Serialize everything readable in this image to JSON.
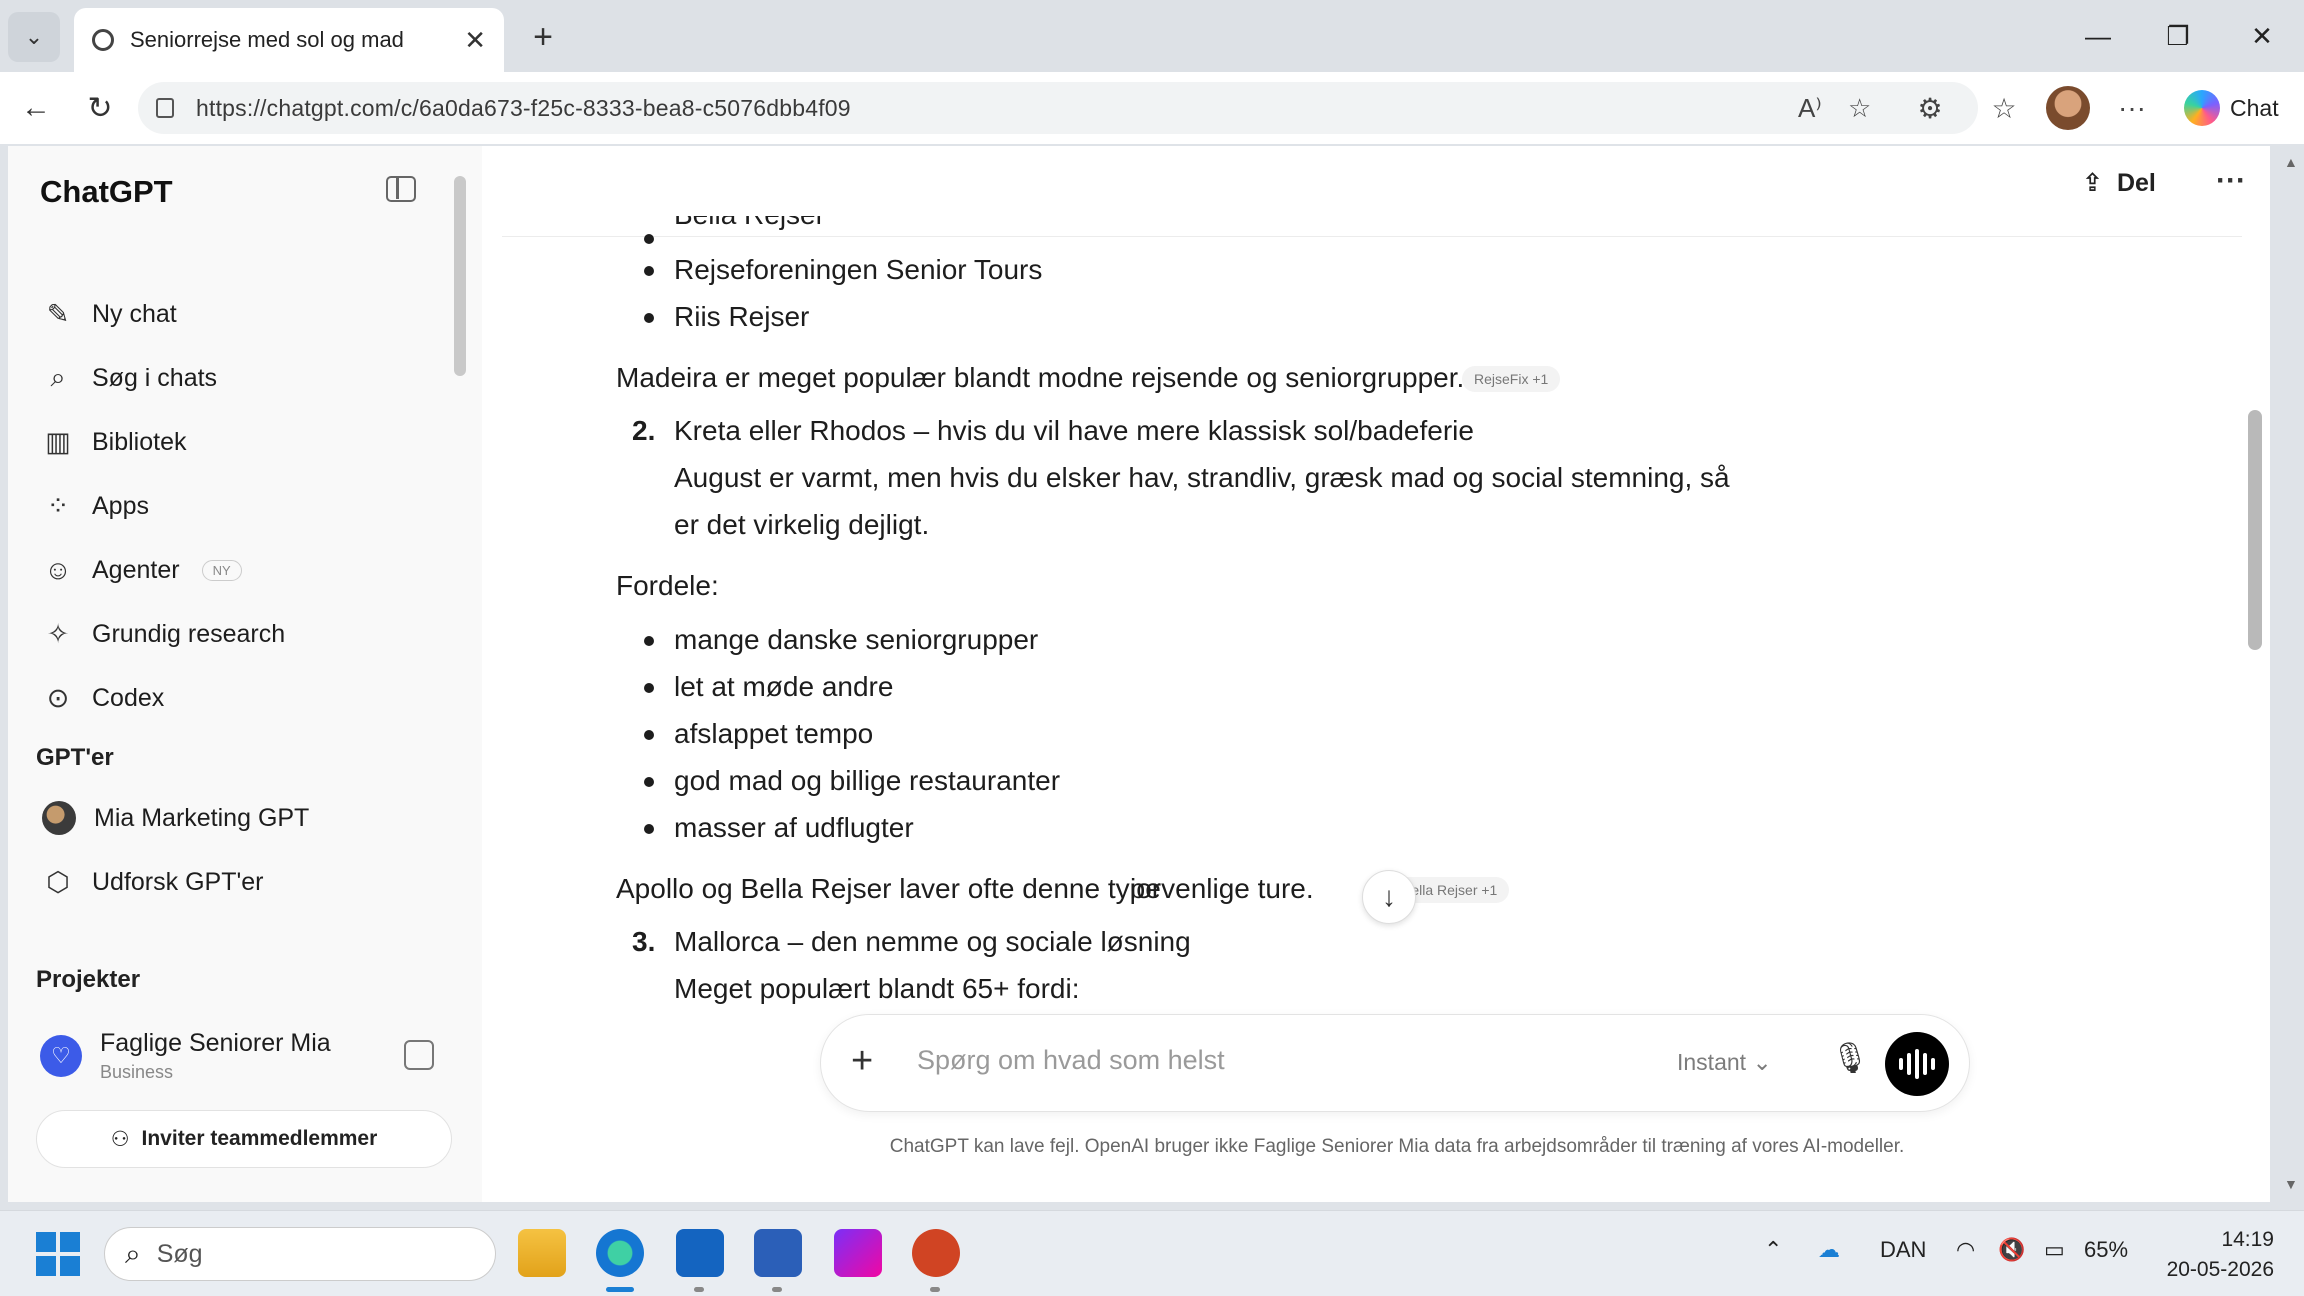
{
  "browser": {
    "tab_title": "Seniorrejse med sol og mad",
    "url": "https://chatgpt.com/c/6a0da673-f25c-8333-bea8-c5076dbb4f09",
    "copilot_label": "Chat"
  },
  "sidebar": {
    "title": "ChatGPT",
    "items": [
      {
        "label": "Ny chat",
        "icon": "edit-icon"
      },
      {
        "label": "Søg i chats",
        "icon": "search-icon"
      },
      {
        "label": "Bibliotek",
        "icon": "library-icon"
      },
      {
        "label": "Apps",
        "icon": "apps-icon"
      },
      {
        "label": "Agenter",
        "icon": "agent-icon",
        "badge": "NY"
      },
      {
        "label": "Grundig research",
        "icon": "telescope-icon"
      },
      {
        "label": "Codex",
        "icon": "codex-icon"
      }
    ],
    "gpts_heading": "GPT'er",
    "gpts": [
      {
        "label": "Mia Marketing GPT",
        "icon": "gpt-avatar"
      },
      {
        "label": "Udforsk GPT'er",
        "icon": "cube-icon"
      }
    ],
    "projects_heading": "Projekter",
    "workspace": {
      "name": "Faglige Seniorer Mia",
      "plan": "Business"
    },
    "invite_label": "Inviter teammedlemmer"
  },
  "header": {
    "share_label": "Del"
  },
  "conversation": {
    "top_bullets_partial": "Bella Rejser",
    "top_bullets": [
      "Rejseforeningen Senior Tours",
      "Riis Rejser"
    ],
    "madeira_note": "Madeira er meget populær blandt modne rejsende og seniorgrupper.",
    "madeira_cite": "RejseFix +1",
    "item2_num": "2.",
    "item2_title": "Kreta eller Rhodos – hvis du vil have mere klassisk sol/badeferie",
    "item2_body_line1": "August er varmt, men hvis du elsker hav, strandliv, græsk mad og social stemning, så",
    "item2_body_line2": "er det virkelig dejligt.",
    "pros_heading": "Fordele:",
    "pros": [
      "mange danske seniorgrupper",
      "let at møde andre",
      "afslappet tempo",
      "god mad og billige restauranter",
      "masser af udflugter"
    ],
    "apollo_note_part1": "Apollo og Bella Rejser laver ofte denne type",
    "apollo_note_part2": "iorvenlige ture.",
    "apollo_cite": "Bella Rejser +1",
    "item3_num": "3.",
    "item3_title": "Mallorca – den nemme og sociale løsning",
    "item3_body_partial": "Meget populært blandt 65+ fordi:"
  },
  "composer": {
    "placeholder": "Spørg om hvad som helst",
    "mode": "Instant"
  },
  "disclaimer": "ChatGPT kan lave fejl. OpenAI bruger ikke Faglige Seniorer Mia data fra arbejdsområder til træning af vores AI-modeller.",
  "taskbar": {
    "search_label": "Søg",
    "language": "DAN",
    "battery": "65%",
    "time": "14:19",
    "date": "20-05-2026"
  },
  "colors": {
    "accent_project": "#3c5be8",
    "windows_blue": "#1a7fd4"
  }
}
